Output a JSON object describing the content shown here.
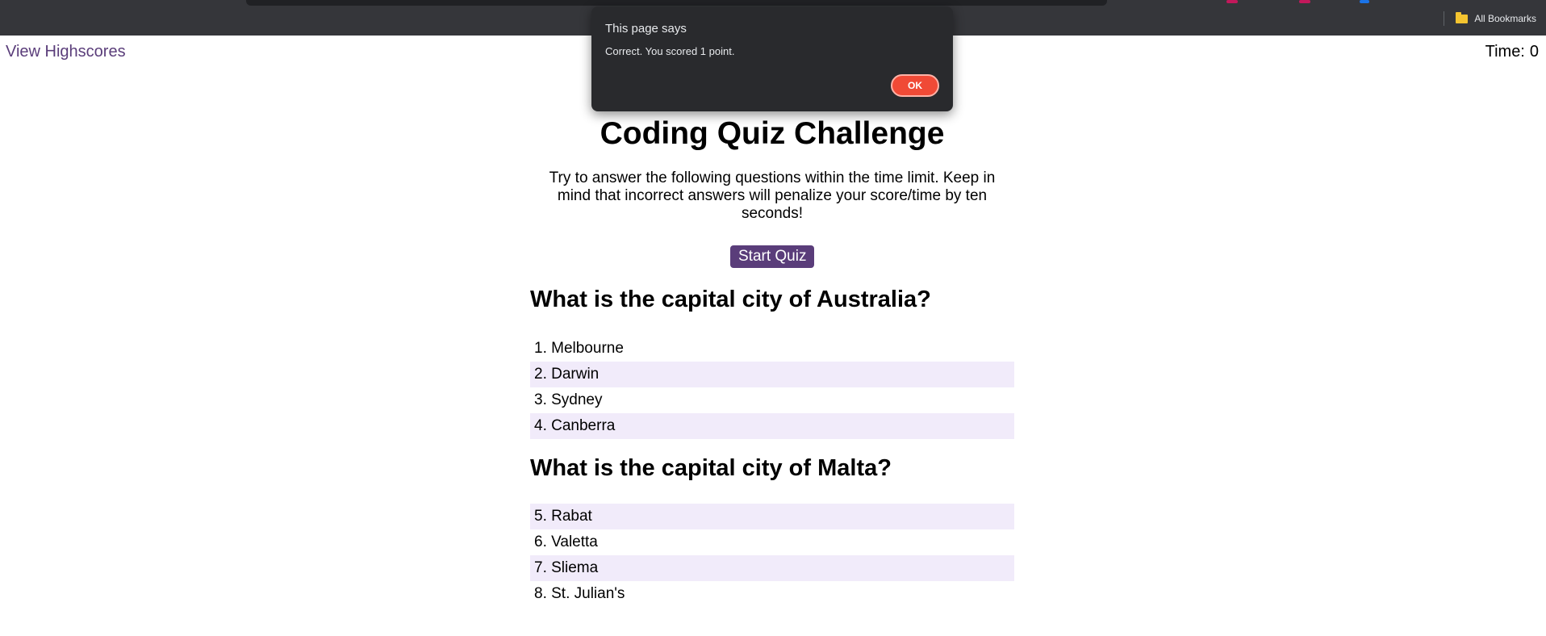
{
  "browser": {
    "bookmarks_label": "All Bookmarks"
  },
  "header": {
    "highscores_link": "View Highscores",
    "timer_label": "Time:",
    "timer_value": "0"
  },
  "main": {
    "title": "Coding Quiz Challenge",
    "intro": "Try to answer the following questions within the time limit. Keep in mind that incorrect answers will penalize your score/time by ten seconds!",
    "start_button": "Start Quiz"
  },
  "questions": [
    {
      "text": "What is the capital city of Australia?",
      "answers": [
        "1. Melbourne",
        "2. Darwin",
        "3. Sydney",
        "4. Canberra"
      ]
    },
    {
      "text": "What is the capital city of Malta?",
      "answers": [
        "5. Rabat",
        "6. Valetta",
        "7. Sliema",
        "8. St. Julian's"
      ]
    }
  ],
  "dialog": {
    "title": "This page says",
    "message": "Correct. You scored 1 point.",
    "ok_label": "OK"
  },
  "colors": {
    "accent": "#5a3d7a",
    "row_highlight": "#f1ebfa",
    "dialog_bg": "#292a2d",
    "ok_button": "#f04a36"
  }
}
